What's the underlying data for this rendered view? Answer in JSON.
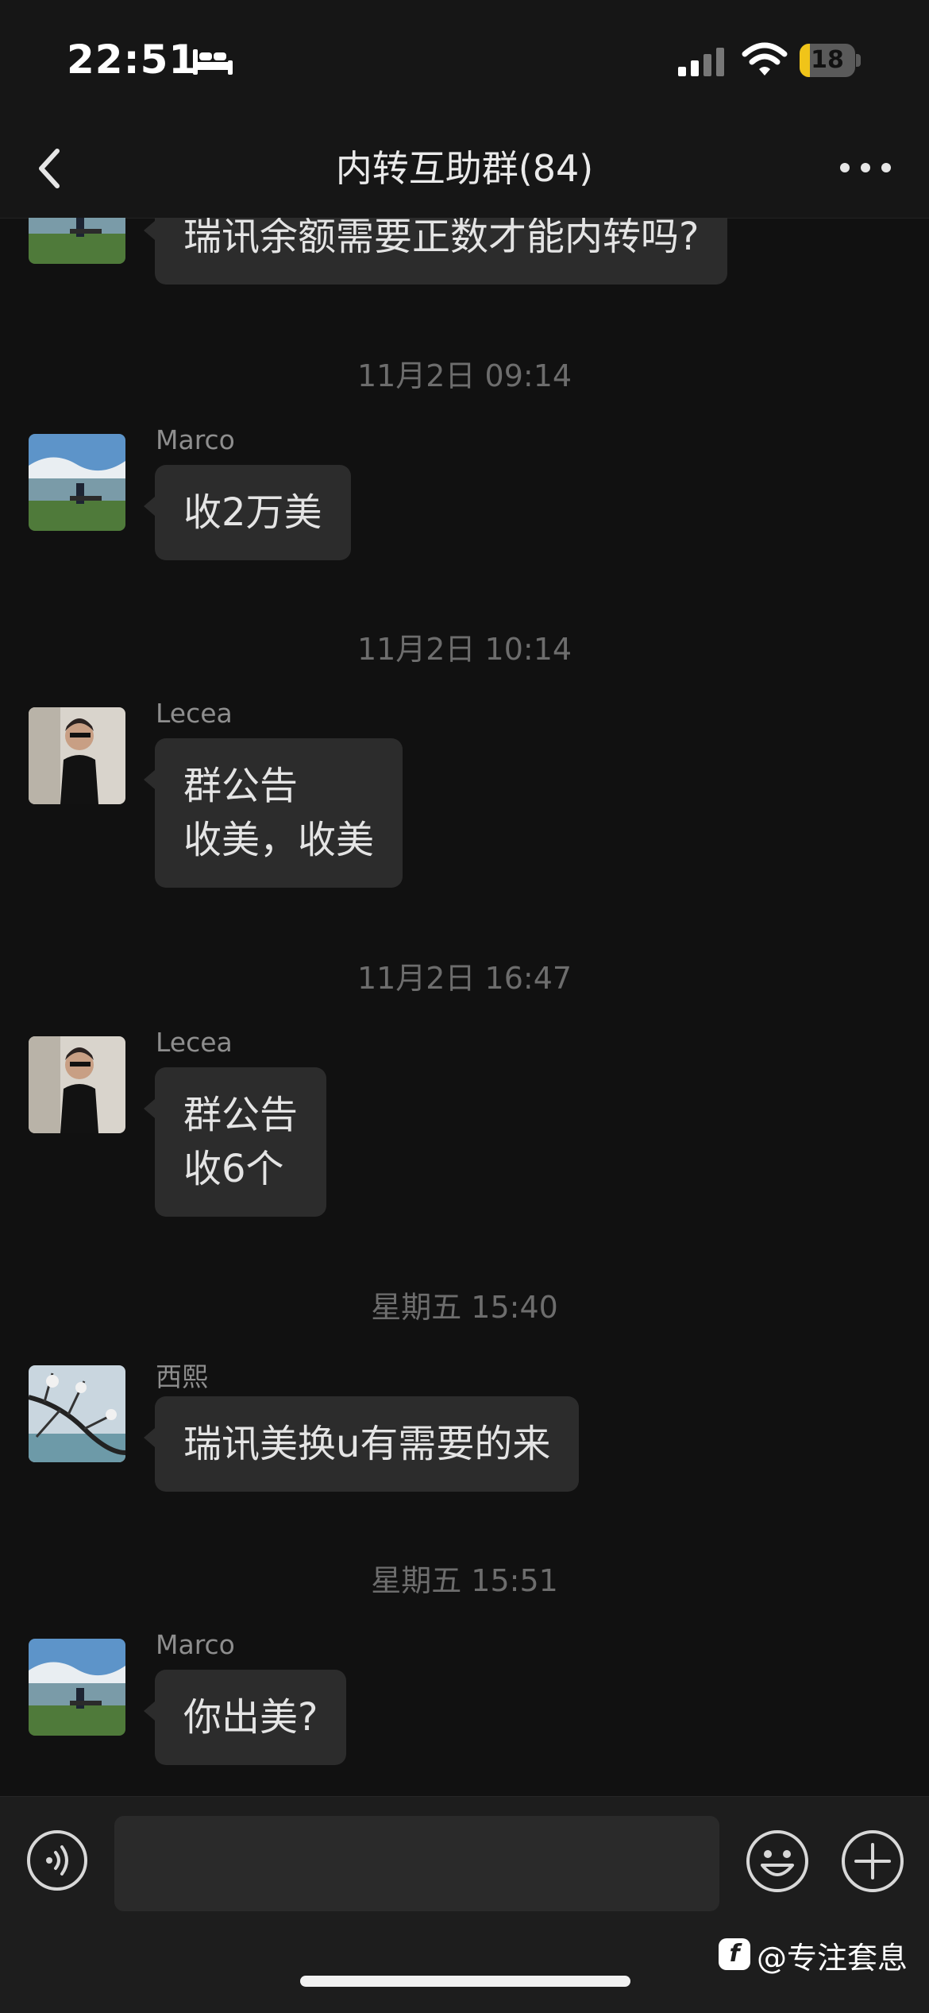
{
  "status_bar": {
    "time": "22:51",
    "sleep_icon": "bed-icon",
    "signal_icon": "cellular-signal-icon",
    "wifi_icon": "wifi-icon",
    "battery_level": "18",
    "battery_fraction": 0.18,
    "battery_color": "#f0c419"
  },
  "nav": {
    "back_icon": "chevron-left-icon",
    "title": "内转互助群(84)",
    "more_icon": "more-dots-icon"
  },
  "messages": [
    {
      "sender": "",
      "text": "瑞讯余额需要正数才能内转吗?",
      "avatar": "lake-landscape-avatar"
    },
    {
      "sender": "Marco",
      "text": "收2万美",
      "avatar": "lake-landscape-avatar"
    },
    {
      "sender": "Lecea",
      "text": "群公告\n收美，收美",
      "avatar": "woman-portrait-avatar"
    },
    {
      "sender": "Lecea",
      "text": "群公告\n收6个",
      "avatar": "woman-portrait-avatar"
    },
    {
      "sender": "西熙",
      "text": "瑞讯美换u有需要的来",
      "avatar": "tree-branches-avatar"
    },
    {
      "sender": "Marco",
      "text": "你出美?",
      "avatar": "lake-landscape-avatar"
    }
  ],
  "timestamps": [
    "11月2日 09:14",
    "11月2日 10:14",
    "11月2日 16:47",
    "星期五 15:40",
    "星期五 15:51"
  ],
  "input_bar": {
    "voice_icon": "voice-input-icon",
    "emoji_icon": "emoji-icon",
    "plus_icon": "plus-icon",
    "message_value": ""
  },
  "watermark": {
    "logo_letter": "f",
    "text": "@专注套息"
  },
  "colors": {
    "background": "#111111",
    "bubble": "#2c2c2c",
    "bar": "#1d1d1d"
  }
}
